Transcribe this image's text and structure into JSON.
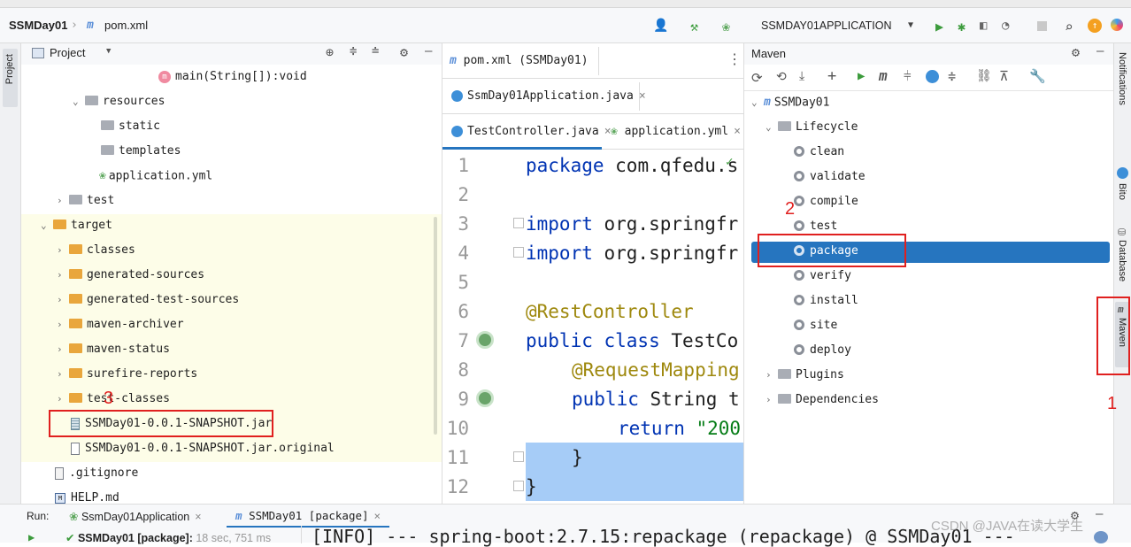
{
  "navbar": {
    "project": "SSMDay01",
    "file": "pom.xml",
    "run_config": "SSMDAY01APPLICATION"
  },
  "left_strip": {
    "project_label": "Project"
  },
  "right_strip": {
    "notifications": "Notifications",
    "bito": "Bito",
    "database": "Database",
    "maven": "Maven"
  },
  "project_panel": {
    "title": "Project",
    "tree": {
      "main_method": "main(String[]):void",
      "resources": "resources",
      "static": "static",
      "templates": "templates",
      "application_yml": "application.yml",
      "test": "test",
      "target": "target",
      "classes": "classes",
      "generated_sources": "generated-sources",
      "generated_test_sources": "generated-test-sources",
      "maven_archiver": "maven-archiver",
      "maven_status": "maven-status",
      "surefire_reports": "surefire-reports",
      "test_classes": "test-classes",
      "jar": "SSMDay01-0.0.1-SNAPSHOT.jar",
      "jar_original": "SSMDay01-0.0.1-SNAPSHOT.jar.original",
      "gitignore": ".gitignore",
      "help": "HELP.md"
    }
  },
  "editor": {
    "tabs": {
      "pom": "pom.xml (SSMDay01)",
      "app": "SsmDay01Application.java",
      "controller": "TestController.java",
      "yml": "application.yml"
    },
    "line_numbers": [
      "1",
      "2",
      "3",
      "4",
      "5",
      "6",
      "7",
      "8",
      "9",
      "10",
      "11",
      "12"
    ],
    "code": {
      "l1_kw": "package",
      "l1_rest": " com.qfedu.s",
      "l3_kw": "import",
      "l3_rest": " org.springfr",
      "l4_kw": "import",
      "l4_rest": " org.springfr",
      "l6_ann": "@RestController",
      "l7_kw": "public class",
      "l7_rest": " TestCo",
      "l8_ann": "@RequestMapping",
      "l9_kw": "public",
      "l9_rest": " String t",
      "l10_kw": "return",
      "l10_str": " \"200",
      "l11": "}",
      "l12": "}"
    }
  },
  "maven": {
    "title": "Maven",
    "project": "SSMDay01",
    "lifecycle": "Lifecycle",
    "phases": [
      "clean",
      "validate",
      "compile",
      "test",
      "package",
      "verify",
      "install",
      "site",
      "deploy"
    ],
    "plugins": "Plugins",
    "dependencies": "Dependencies"
  },
  "run_bar": {
    "label": "Run:",
    "tab1": "SsmDay01Application",
    "tab2": "SSMDay01 [package]",
    "status_item": "SSMDay01 [package]:",
    "status_time": "18 sec, 751 ms",
    "console": "[INFO] --- spring-boot:2.7.15:repackage (repackage) @ SSMDay01 ---"
  },
  "annotations": {
    "n1": "1",
    "n2": "2",
    "n3": "3"
  },
  "watermark": "CSDN @JAVA在读大学生",
  "colors": {
    "accent": "#2675bf",
    "selection": "#a6ccf7",
    "highlight": "#fdfde8",
    "annotation_red": "#e0201f"
  }
}
